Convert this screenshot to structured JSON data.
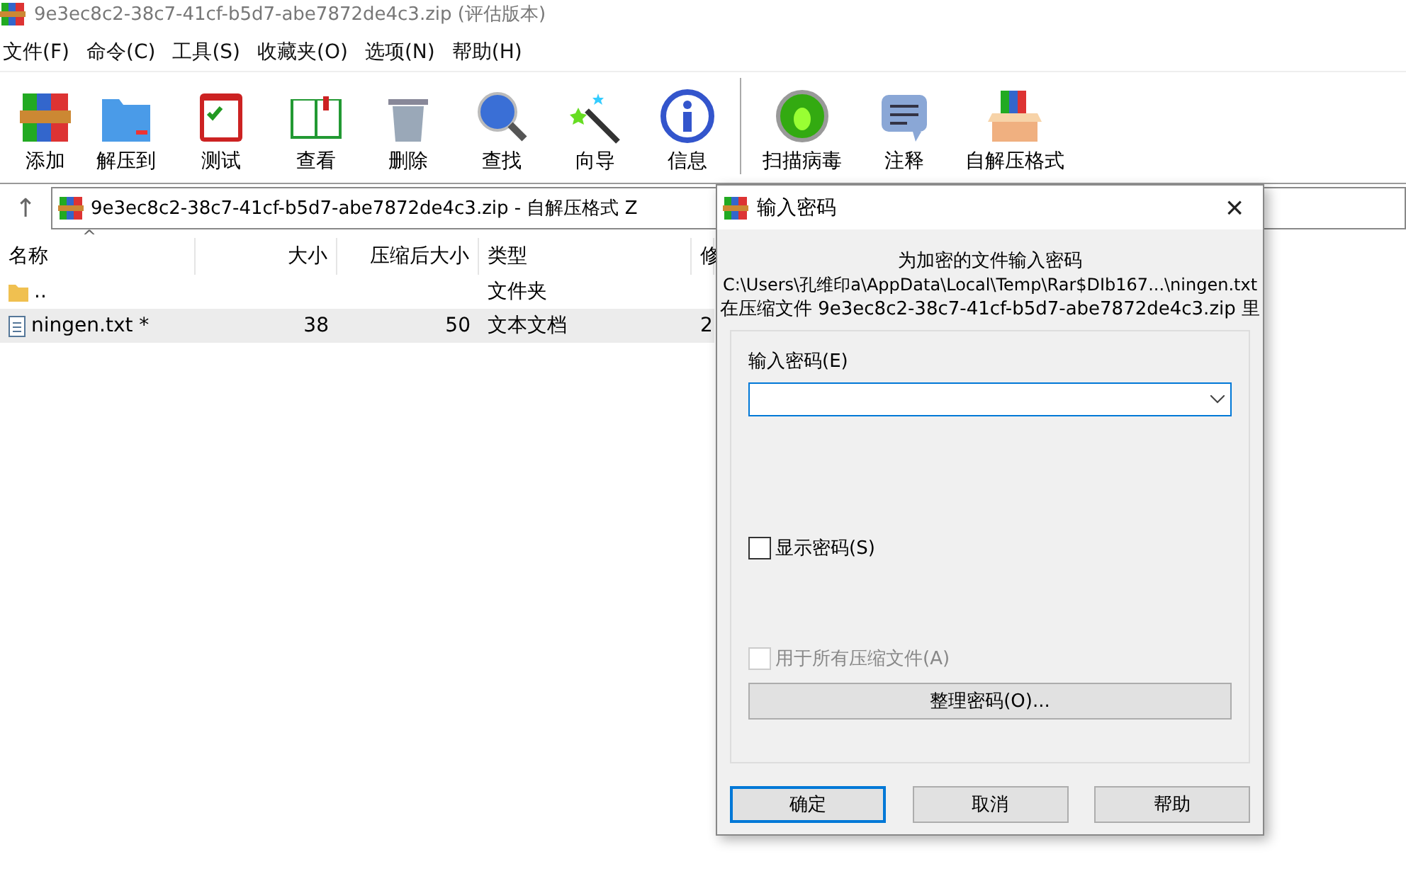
{
  "window": {
    "title": "9e3ec8c2-38c7-41cf-b5d7-abe7872de4c3.zip (评估版本)"
  },
  "menu": [
    "文件(F)",
    "命令(C)",
    "工具(S)",
    "收藏夹(O)",
    "选项(N)",
    "帮助(H)"
  ],
  "toolbar": [
    {
      "label": "添加",
      "separator_before": false
    },
    {
      "label": "解压到",
      "separator_before": false
    },
    {
      "label": "测试",
      "separator_before": false
    },
    {
      "label": "查看",
      "separator_before": false
    },
    {
      "label": "删除",
      "separator_before": false
    },
    {
      "label": "查找",
      "separator_before": false
    },
    {
      "label": "向导",
      "separator_before": false
    },
    {
      "label": "信息",
      "separator_before": false
    },
    {
      "label": "扫描病毒",
      "separator_before": true
    },
    {
      "label": "注释",
      "separator_before": false
    },
    {
      "label": "自解压格式",
      "separator_before": false
    }
  ],
  "address": {
    "up": "↑",
    "path": "9e3ec8c2-38c7-41cf-b5d7-abe7872de4c3.zip - 自解压格式 Z"
  },
  "table": {
    "sort_mark": "^",
    "columns": [
      "名称",
      "大小",
      "压缩后大小",
      "类型",
      "修"
    ],
    "rows": [
      {
        "kind": "folder",
        "name": "..",
        "type": "文件夹",
        "selected": false
      },
      {
        "kind": "file",
        "name": "ningen.txt *",
        "size": "38",
        "packed": "50",
        "type": "文本文档",
        "modified": "2",
        "selected": true
      }
    ]
  },
  "dialog": {
    "title": "输入密码",
    "close": "×",
    "heading": "为加密的文件输入密码",
    "path": "C:\\Users\\孔维印a\\AppData\\Local\\Temp\\Rar$DIb167...\\ningen.txt",
    "archive_line": "在压缩文件 9e3ec8c2-38c7-41cf-b5d7-abe7872de4c3.zip 里",
    "field_label": "输入密码(E)",
    "checkboxes": [
      {
        "label": "显示密码(S)",
        "checked": false,
        "disabled": false
      },
      {
        "label": "用于所有压缩文件(A)",
        "checked": false,
        "disabled": true
      }
    ],
    "organize_button": "整理密码(O)...",
    "buttons": [
      {
        "label": "确定",
        "default": true
      },
      {
        "label": "取消",
        "default": false
      },
      {
        "label": "帮助",
        "default": false
      }
    ]
  }
}
